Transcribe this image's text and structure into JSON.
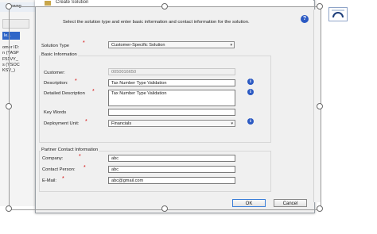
{
  "background_app": {
    "title_fragment": "mowng",
    "header_fragment": "le...",
    "list_lines": [
      "omer ID:",
      "n (YASP",
      "F51VY_",
      "s (YSOC",
      "KSV_)"
    ]
  },
  "dialog": {
    "title": "Create Solution",
    "instruction": "Select the solution type and enter basic information and contact information for the solution.",
    "help_icon_glyph": "?",
    "solution_type": {
      "label": "Solution Type",
      "value": "Customer-Specific Solution"
    },
    "basic_info": {
      "title": "Basic Information",
      "customer": {
        "label": "Customer:",
        "value": "0050016650"
      },
      "description": {
        "label": "Description:",
        "value": "Tax Number Type Validation"
      },
      "detailed_description": {
        "label": "Detailed Description",
        "value": "Tax Number Type Validation"
      },
      "key_words": {
        "label": "Key Words",
        "value": ""
      },
      "deployment_unit": {
        "label": "Deployment Unit:",
        "value": "Financials"
      }
    },
    "partner_contact": {
      "title": "Partner Contact Information",
      "company": {
        "label": "Company:",
        "value": "abc"
      },
      "contact_person": {
        "label": "Contact Person:",
        "value": "abc"
      },
      "email": {
        "label": "E-Mail:",
        "value": "abc@gmail.com"
      }
    },
    "buttons": {
      "ok": "OK",
      "cancel": "Cancel"
    },
    "required_mark": "*",
    "info_glyph": "i",
    "dropdown_glyph": "▾"
  },
  "colors": {
    "accent": "#2b59c3",
    "required": "#d40000",
    "dialog_bg": "#f0f0f0"
  }
}
